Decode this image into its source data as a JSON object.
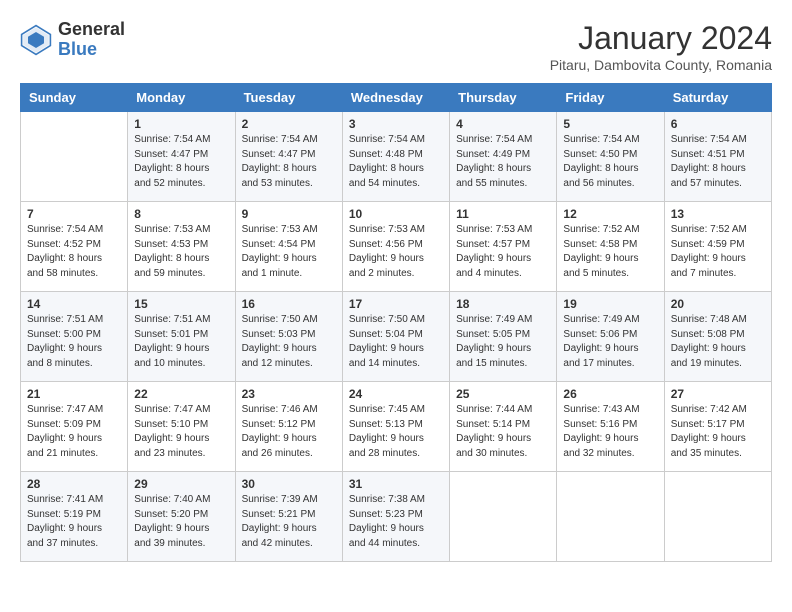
{
  "header": {
    "logo_general": "General",
    "logo_blue": "Blue",
    "month_title": "January 2024",
    "location": "Pitaru, Dambovita County, Romania"
  },
  "days_of_week": [
    "Sunday",
    "Monday",
    "Tuesday",
    "Wednesday",
    "Thursday",
    "Friday",
    "Saturday"
  ],
  "weeks": [
    [
      {
        "day": "",
        "sunrise": "",
        "sunset": "",
        "daylight": ""
      },
      {
        "day": "1",
        "sunrise": "Sunrise: 7:54 AM",
        "sunset": "Sunset: 4:47 PM",
        "daylight": "Daylight: 8 hours and 52 minutes."
      },
      {
        "day": "2",
        "sunrise": "Sunrise: 7:54 AM",
        "sunset": "Sunset: 4:47 PM",
        "daylight": "Daylight: 8 hours and 53 minutes."
      },
      {
        "day": "3",
        "sunrise": "Sunrise: 7:54 AM",
        "sunset": "Sunset: 4:48 PM",
        "daylight": "Daylight: 8 hours and 54 minutes."
      },
      {
        "day": "4",
        "sunrise": "Sunrise: 7:54 AM",
        "sunset": "Sunset: 4:49 PM",
        "daylight": "Daylight: 8 hours and 55 minutes."
      },
      {
        "day": "5",
        "sunrise": "Sunrise: 7:54 AM",
        "sunset": "Sunset: 4:50 PM",
        "daylight": "Daylight: 8 hours and 56 minutes."
      },
      {
        "day": "6",
        "sunrise": "Sunrise: 7:54 AM",
        "sunset": "Sunset: 4:51 PM",
        "daylight": "Daylight: 8 hours and 57 minutes."
      }
    ],
    [
      {
        "day": "7",
        "sunrise": "Sunrise: 7:54 AM",
        "sunset": "Sunset: 4:52 PM",
        "daylight": "Daylight: 8 hours and 58 minutes."
      },
      {
        "day": "8",
        "sunrise": "Sunrise: 7:53 AM",
        "sunset": "Sunset: 4:53 PM",
        "daylight": "Daylight: 8 hours and 59 minutes."
      },
      {
        "day": "9",
        "sunrise": "Sunrise: 7:53 AM",
        "sunset": "Sunset: 4:54 PM",
        "daylight": "Daylight: 9 hours and 1 minute."
      },
      {
        "day": "10",
        "sunrise": "Sunrise: 7:53 AM",
        "sunset": "Sunset: 4:56 PM",
        "daylight": "Daylight: 9 hours and 2 minutes."
      },
      {
        "day": "11",
        "sunrise": "Sunrise: 7:53 AM",
        "sunset": "Sunset: 4:57 PM",
        "daylight": "Daylight: 9 hours and 4 minutes."
      },
      {
        "day": "12",
        "sunrise": "Sunrise: 7:52 AM",
        "sunset": "Sunset: 4:58 PM",
        "daylight": "Daylight: 9 hours and 5 minutes."
      },
      {
        "day": "13",
        "sunrise": "Sunrise: 7:52 AM",
        "sunset": "Sunset: 4:59 PM",
        "daylight": "Daylight: 9 hours and 7 minutes."
      }
    ],
    [
      {
        "day": "14",
        "sunrise": "Sunrise: 7:51 AM",
        "sunset": "Sunset: 5:00 PM",
        "daylight": "Daylight: 9 hours and 8 minutes."
      },
      {
        "day": "15",
        "sunrise": "Sunrise: 7:51 AM",
        "sunset": "Sunset: 5:01 PM",
        "daylight": "Daylight: 9 hours and 10 minutes."
      },
      {
        "day": "16",
        "sunrise": "Sunrise: 7:50 AM",
        "sunset": "Sunset: 5:03 PM",
        "daylight": "Daylight: 9 hours and 12 minutes."
      },
      {
        "day": "17",
        "sunrise": "Sunrise: 7:50 AM",
        "sunset": "Sunset: 5:04 PM",
        "daylight": "Daylight: 9 hours and 14 minutes."
      },
      {
        "day": "18",
        "sunrise": "Sunrise: 7:49 AM",
        "sunset": "Sunset: 5:05 PM",
        "daylight": "Daylight: 9 hours and 15 minutes."
      },
      {
        "day": "19",
        "sunrise": "Sunrise: 7:49 AM",
        "sunset": "Sunset: 5:06 PM",
        "daylight": "Daylight: 9 hours and 17 minutes."
      },
      {
        "day": "20",
        "sunrise": "Sunrise: 7:48 AM",
        "sunset": "Sunset: 5:08 PM",
        "daylight": "Daylight: 9 hours and 19 minutes."
      }
    ],
    [
      {
        "day": "21",
        "sunrise": "Sunrise: 7:47 AM",
        "sunset": "Sunset: 5:09 PM",
        "daylight": "Daylight: 9 hours and 21 minutes."
      },
      {
        "day": "22",
        "sunrise": "Sunrise: 7:47 AM",
        "sunset": "Sunset: 5:10 PM",
        "daylight": "Daylight: 9 hours and 23 minutes."
      },
      {
        "day": "23",
        "sunrise": "Sunrise: 7:46 AM",
        "sunset": "Sunset: 5:12 PM",
        "daylight": "Daylight: 9 hours and 26 minutes."
      },
      {
        "day": "24",
        "sunrise": "Sunrise: 7:45 AM",
        "sunset": "Sunset: 5:13 PM",
        "daylight": "Daylight: 9 hours and 28 minutes."
      },
      {
        "day": "25",
        "sunrise": "Sunrise: 7:44 AM",
        "sunset": "Sunset: 5:14 PM",
        "daylight": "Daylight: 9 hours and 30 minutes."
      },
      {
        "day": "26",
        "sunrise": "Sunrise: 7:43 AM",
        "sunset": "Sunset: 5:16 PM",
        "daylight": "Daylight: 9 hours and 32 minutes."
      },
      {
        "day": "27",
        "sunrise": "Sunrise: 7:42 AM",
        "sunset": "Sunset: 5:17 PM",
        "daylight": "Daylight: 9 hours and 35 minutes."
      }
    ],
    [
      {
        "day": "28",
        "sunrise": "Sunrise: 7:41 AM",
        "sunset": "Sunset: 5:19 PM",
        "daylight": "Daylight: 9 hours and 37 minutes."
      },
      {
        "day": "29",
        "sunrise": "Sunrise: 7:40 AM",
        "sunset": "Sunset: 5:20 PM",
        "daylight": "Daylight: 9 hours and 39 minutes."
      },
      {
        "day": "30",
        "sunrise": "Sunrise: 7:39 AM",
        "sunset": "Sunset: 5:21 PM",
        "daylight": "Daylight: 9 hours and 42 minutes."
      },
      {
        "day": "31",
        "sunrise": "Sunrise: 7:38 AM",
        "sunset": "Sunset: 5:23 PM",
        "daylight": "Daylight: 9 hours and 44 minutes."
      },
      {
        "day": "",
        "sunrise": "",
        "sunset": "",
        "daylight": ""
      },
      {
        "day": "",
        "sunrise": "",
        "sunset": "",
        "daylight": ""
      },
      {
        "day": "",
        "sunrise": "",
        "sunset": "",
        "daylight": ""
      }
    ]
  ]
}
